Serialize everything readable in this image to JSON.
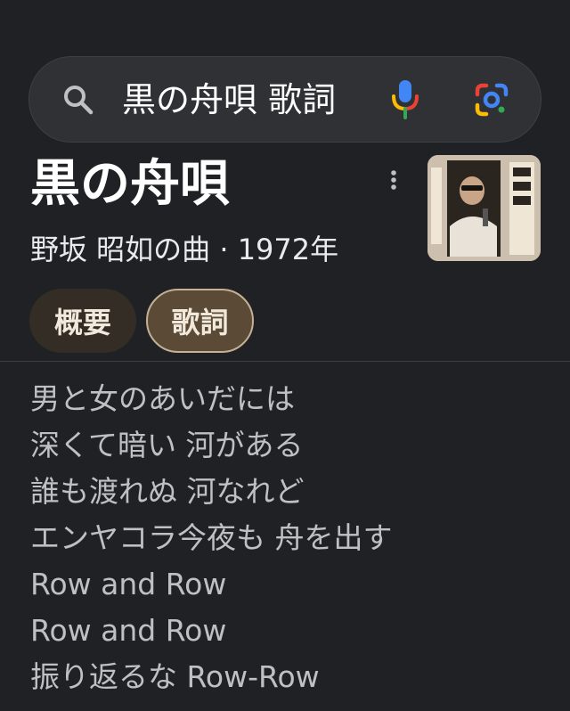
{
  "search": {
    "query": "黒の舟唄 歌詞",
    "icons": {
      "search": "search-icon",
      "voice": "mic-icon",
      "lens": "google-lens-icon"
    }
  },
  "knowledge_panel": {
    "title": "黒の舟唄",
    "subtitle": "野坂 昭如の曲 · 1972年",
    "more_icon": "more-vert-icon",
    "chips": [
      {
        "label": "概要",
        "selected": false
      },
      {
        "label": "歌詞",
        "selected": true
      }
    ]
  },
  "lyrics": [
    "男と女のあいだには",
    "深くて暗い 河がある",
    "誰も渡れぬ 河なれど",
    "エンヤコラ今夜も 舟を出す",
    "Row and Row",
    "Row and Row",
    "振り返るな Row-Row"
  ],
  "colors": {
    "background": "#202124",
    "search_bar": "#303134",
    "chip_selected": "#5a4a36",
    "chip_unselected": "#332d25",
    "lyrics_text": "#bdc1c6"
  }
}
